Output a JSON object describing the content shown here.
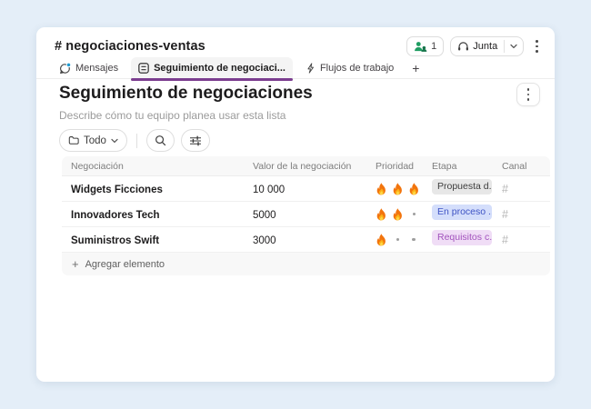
{
  "window": {
    "header": {
      "channel_name": "# negociaciones-ventas",
      "member_count": "1",
      "huddle_label": "Junta"
    },
    "tabs": [
      {
        "label": "Mensajes"
      },
      {
        "label": "Seguimiento de negociaci..."
      },
      {
        "label": "Flujos de trabajo"
      },
      {
        "label": "+"
      }
    ]
  },
  "list": {
    "title": "Seguimiento de negociaciones",
    "description": "Describe cómo tu equipo planea usar esta lista",
    "toolbar": {
      "view_filter_label": "Todo"
    },
    "table": {
      "columns": [
        "Negociación",
        "Valor de la negociación",
        "Prioridad",
        "Etapa",
        "Canal"
      ],
      "priority_max": 3,
      "rows": [
        {
          "name": "Widgets Ficciones",
          "value": "10 000",
          "priority": 3,
          "stage": "Propuesta d...",
          "stage_color": "gray",
          "channel_glyph": "#"
        },
        {
          "name": "Innovadores Tech",
          "value": "5000",
          "priority": 2,
          "stage": "En proceso ...",
          "stage_color": "blue",
          "channel_glyph": "#"
        },
        {
          "name": "Suministros Swift",
          "value": "3000",
          "priority": 1,
          "stage": "Requisitos c...",
          "stage_color": "purple",
          "channel_glyph": "#"
        }
      ],
      "add_item_label": "Agregar elemento"
    }
  },
  "colors": {
    "page_background": "#e4eef8",
    "accent_tab_underline": "#7b3d8f",
    "presence_green": "#1f9d62",
    "unread_blue": "#1d9bd1",
    "stage": {
      "gray": {
        "bg": "#e7e7e7",
        "fg": "#3d3d3d"
      },
      "blue": {
        "bg": "#d4defb",
        "fg": "#3e53c4"
      },
      "purple": {
        "bg": "#f0ddf6",
        "fg": "#a253bd"
      }
    }
  }
}
